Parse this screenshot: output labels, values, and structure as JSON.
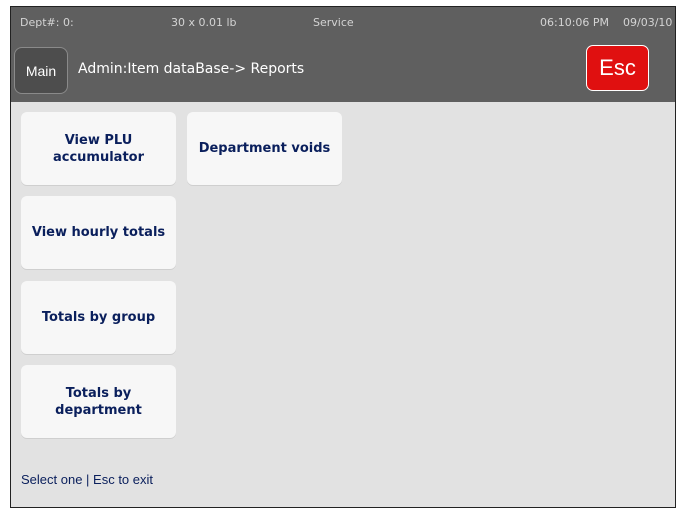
{
  "status_bar": {
    "dept": "Dept#: 0:",
    "weight": "30 x 0.01 lb",
    "mode": "Service",
    "time": "06:10:06 PM",
    "date": "09/03/10"
  },
  "header": {
    "main_label": "Main",
    "title": "Admin:Item dataBase-> Reports",
    "esc_label": "Esc"
  },
  "menu": {
    "view_plu": "View PLU\naccumulator",
    "view_hourly": "View hourly totals",
    "totals_group": "Totals by group",
    "totals_department": "Totals by\ndepartment",
    "department_voids": "Department voids"
  },
  "footer": {
    "hint": "Select one | Esc to exit"
  },
  "colors": {
    "header_bg": "#5f5f5f",
    "content_bg": "#e2e2e2",
    "tile_bg": "#f7f7f7",
    "tile_text": "#0a1f5c",
    "esc_bg": "#e01010"
  }
}
